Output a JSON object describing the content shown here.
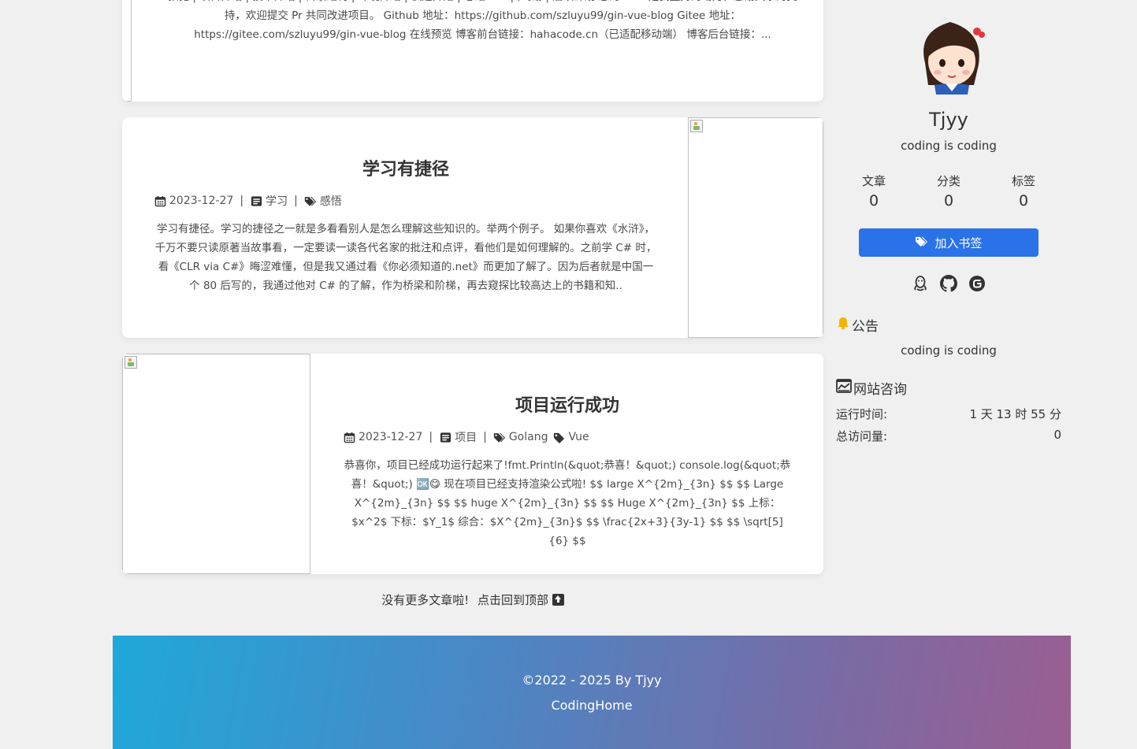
{
  "articles": [
    {
      "summary": "预览 | 项目介绍 | 技术介绍 | 目录结构 | 环境介绍 | 快速开始 | 总结&amp;鸣谢 | 后续计划 您的 Star 是我坚持的动力，感谢大家的支持，欢迎提交 Pr 共同改进项目。 Github 地址：https://github.com/szluyu99/gin-vue-blog Gitee 地址：https://gitee.com/szluyu99/gin-vue-blog 在线预览 博客前台链接：hahacode.cn（已适配移动端） 博客后台链接：..."
    },
    {
      "title": "学习有捷径",
      "date": "2023-12-27",
      "category": "学习",
      "tags": [
        "感悟"
      ],
      "summary": "学习有捷径。学习的捷径之一就是多看看别人是怎么理解这些知识的。举两个例子。 如果你喜欢《水浒》，千万不要只读原著当故事看，一定要读一读各代名家的批注和点评，看他们是如何理解的。之前学 C# 时，看《CLR via C#》晦涩难懂，但是我又通过看《你必须知道的.net》而更加了解了。因为后者就是中国一个 80 后写的，我通过他对 C# 的了解，作为桥梁和阶梯，再去窥探比较高达上的书籍和知.."
    },
    {
      "title": "项目运行成功",
      "date": "2023-12-27",
      "category": "项目",
      "tags": [
        "Golang",
        "Vue"
      ],
      "summary": "恭喜你，项目已经成功运行起来了!fmt.Println(&quot;恭喜！&quot;) console.log(&quot;恭喜！&quot;) 🆗😋 现在项目已经支持渲染公式啦! $$ large X^{2m}_{3n} $$ $$ Large X^{2m}_{3n} $$ $$ huge X^{2m}_{3n} $$ $$ Huge X^{2m}_{3n} $$ 上标：$x^2$ 下标：$Y_1$ 综合：$X^{2m}_{3n}$ $$ \\frac{2x+3}{3y-1} $$ $$ \\sqrt[5]{6} $$"
    }
  ],
  "no_more": {
    "text": "没有更多文章啦!",
    "link": "点击回到顶部"
  },
  "sidebar": {
    "author_name": "Tjyy",
    "author_desc": "coding is coding",
    "stats": [
      {
        "label": "文章",
        "value": "0"
      },
      {
        "label": "分类",
        "value": "0"
      },
      {
        "label": "标签",
        "value": "0"
      }
    ],
    "bookmark_label": "加入书签",
    "socials": [
      "qq-icon",
      "github-icon",
      "gitee-icon"
    ],
    "announce_title": "公告",
    "announce_text": "coding is coding",
    "info_title": "网站咨询",
    "info": [
      {
        "label": "运行时间:",
        "value": "1 天 13 时 55 分"
      },
      {
        "label": "总访问量:",
        "value": "0"
      }
    ]
  },
  "footer": {
    "copyright": "©2022 - 2025 By Tjyy",
    "site_name": "CodingHome"
  },
  "colors": {
    "accent": "#2a72e8",
    "footer_gradient_start": "#1fa8da",
    "footer_gradient_end": "#9a5e91"
  }
}
